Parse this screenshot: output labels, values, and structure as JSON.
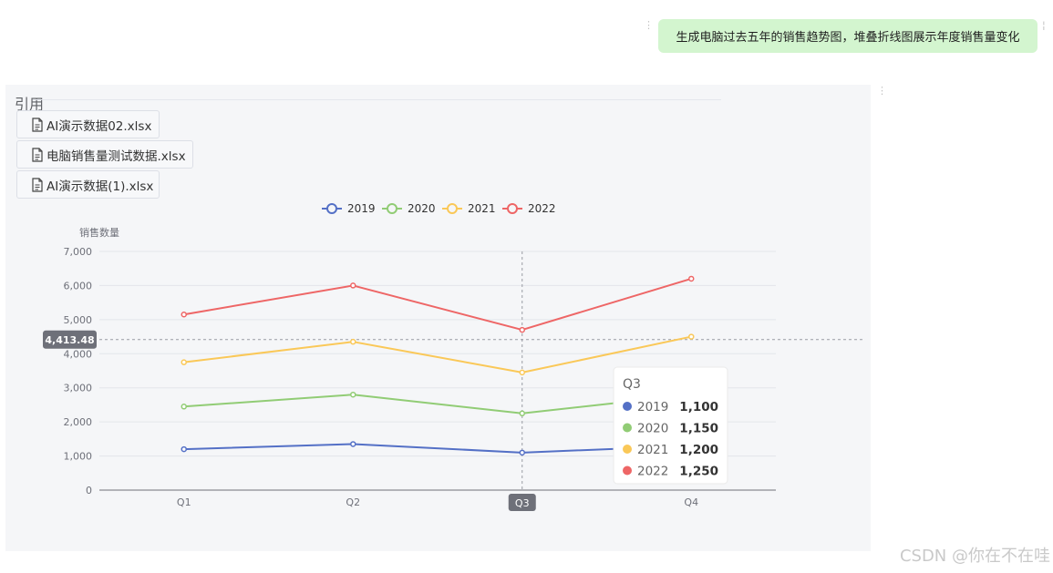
{
  "chat": {
    "user_message": "生成电脑过去五年的销售趋势图，堆叠折线图展示年度销售量变化"
  },
  "references": {
    "title": "引用",
    "files": [
      {
        "name": "AI演示数据02.xlsx",
        "icon": "document-icon"
      },
      {
        "name": "电脑销售量测试数据.xlsx",
        "icon": "document-icon"
      },
      {
        "name": "AI演示数据(1).xlsx",
        "icon": "document-icon"
      }
    ]
  },
  "chart_data": {
    "type": "line",
    "stacked": true,
    "title": "",
    "xlabel": "",
    "ylabel": "销售数量",
    "categories": [
      "Q1",
      "Q2",
      "Q3",
      "Q4"
    ],
    "yticks": [
      "0",
      "1,000",
      "2,000",
      "3,000",
      "4,000",
      "5,000",
      "6,000",
      "7,000"
    ],
    "ylim": [
      0,
      7000
    ],
    "grid": true,
    "legend_position": "top-center",
    "series": [
      {
        "name": "2019",
        "color": "#5470c6",
        "values": [
          1200,
          1350,
          1100,
          1300
        ]
      },
      {
        "name": "2020",
        "color": "#91cc75",
        "values": [
          1250,
          1450,
          1150,
          1500
        ]
      },
      {
        "name": "2021",
        "color": "#fac858",
        "values": [
          1300,
          1550,
          1200,
          1700
        ]
      },
      {
        "name": "2022",
        "color": "#ee6666",
        "values": [
          1400,
          1650,
          1250,
          1700
        ]
      }
    ],
    "crosshair": {
      "category": "Q3",
      "value_label": "4,413.48",
      "y_value": 4413.48
    },
    "tooltip": {
      "title": "Q3",
      "items": [
        {
          "name": "2019",
          "value": "1,100",
          "color": "#5470c6"
        },
        {
          "name": "2020",
          "value": "1,150",
          "color": "#91cc75"
        },
        {
          "name": "2021",
          "value": "1,200",
          "color": "#fac858"
        },
        {
          "name": "2022",
          "value": "1,250",
          "color": "#ee6666"
        }
      ]
    }
  },
  "watermark": "CSDN @你在不在哇"
}
